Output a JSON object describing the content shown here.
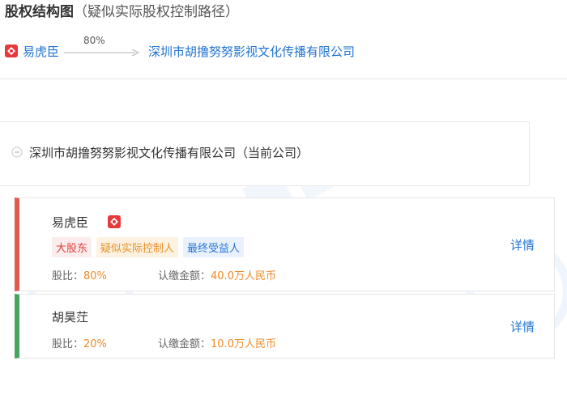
{
  "header": {
    "title_main": "股权结构图",
    "title_sub": "（疑似实际股权控制路径）"
  },
  "control_path": {
    "person": "易虎臣",
    "percentage": "80%",
    "company": "深圳市胡撸努努影视文化传播有限公司"
  },
  "company_node": {
    "name": "深圳市胡撸努努影视文化传播有限公司（当前公司）"
  },
  "shareholders": [
    {
      "name": "易虎臣",
      "tags": [
        "大股东",
        "疑似实际控制人",
        "最终受益人"
      ],
      "ratio_label": "股比：",
      "ratio": "80%",
      "amount_label": "认缴金额：",
      "amount": "40.0万人民币",
      "detail_label": "详情",
      "accent_color": "#e15a4e"
    },
    {
      "name": "胡昊茳",
      "tags": [],
      "ratio_label": "股比：",
      "ratio": "20%",
      "amount_label": "认缴金额：",
      "amount": "10.0万人民币",
      "detail_label": "详情",
      "accent_color": "#49a462"
    }
  ],
  "icons": {
    "person_badge": "person-badge-icon",
    "collapse": "collapse-minus-icon",
    "arrow": "arrow-right-icon"
  },
  "colors": {
    "link": "#1f73d2",
    "highlight": "#f08a24",
    "tag_red": "#e0413d",
    "tag_orange": "#e6902b",
    "tag_blue": "#2a75d3"
  }
}
